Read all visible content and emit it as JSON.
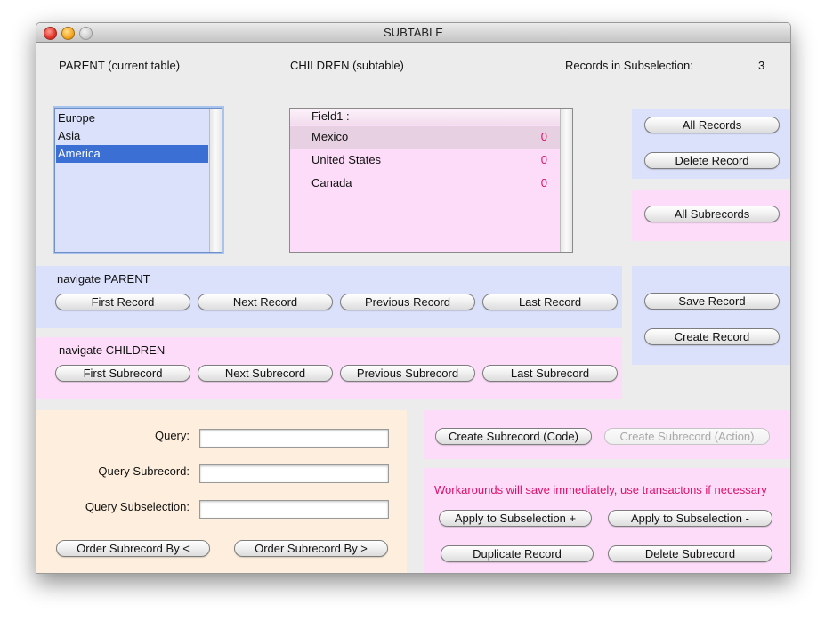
{
  "window": {
    "title": "SUBTABLE"
  },
  "header": {
    "parent_label": "PARENT (current table)",
    "children_label": "CHILDREN (subtable)",
    "records_label": "Records in Subselection:",
    "records_count": "3"
  },
  "parent_list": {
    "items": [
      "Europe",
      "Asia",
      "America"
    ],
    "selected_index": 2
  },
  "subtable": {
    "column_header": "Field1 :",
    "rows": [
      {
        "name": "Mexico",
        "value": "0"
      },
      {
        "name": "United States",
        "value": "0"
      },
      {
        "name": "Canada",
        "value": "0"
      }
    ]
  },
  "right_panel": {
    "all_records": "All Records",
    "delete_record": "Delete Record",
    "all_subrecords": "All Subrecords",
    "save_record": "Save Record",
    "create_record": "Create Record"
  },
  "nav_parent": {
    "label": "navigate PARENT",
    "first": "First Record",
    "next": "Next Record",
    "previous": "Previous Record",
    "last": "Last Record"
  },
  "nav_children": {
    "label": "navigate CHILDREN",
    "first": "First Subrecord",
    "next": "Next Subrecord",
    "previous": "Previous Subrecord",
    "last": "Last Subrecord"
  },
  "query": {
    "query_label": "Query:",
    "query_value": "",
    "subrecord_label": "Query Subrecord:",
    "subrecord_value": "",
    "subselection_label": "Query Subselection:",
    "subselection_value": "",
    "order_lt": "Order Subrecord By <",
    "order_gt": "Order Subrecord By >"
  },
  "create_sub": {
    "code": "Create Subrecord (Code)",
    "action": "Create Subrecord (Action)"
  },
  "workarounds": {
    "warning": "Workarounds will save immediately, use transactons if necessary",
    "apply_plus": "Apply to Subselection +",
    "apply_minus": "Apply to Subselection -",
    "duplicate": "Duplicate Record",
    "delete_sub": "Delete Subrecord"
  },
  "colors": {
    "parent_panel": "#dbe1fb",
    "child_panel": "#fcdcf8",
    "query_panel": "#fdeedd",
    "selection": "#3c6fd4",
    "accent_text": "#e0106a"
  }
}
